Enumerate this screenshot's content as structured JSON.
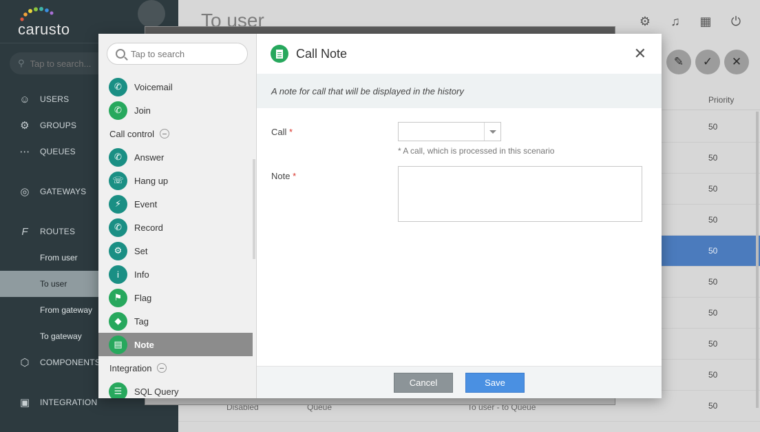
{
  "app": {
    "logo_text": "carusto",
    "page_title": "To user"
  },
  "sidebar": {
    "search_placeholder": "Tap to search...",
    "items": [
      {
        "label": "USERS",
        "icon": "user-icon"
      },
      {
        "label": "GROUPS",
        "icon": "groups-icon"
      },
      {
        "label": "QUEUES",
        "icon": "queues-icon"
      },
      {
        "label": "GATEWAYS",
        "icon": "globe-icon"
      },
      {
        "label": "ROUTES",
        "icon": "fx-icon"
      },
      {
        "label": "COMPONENTS",
        "icon": "cube-icon"
      },
      {
        "label": "INTEGRATION",
        "icon": "integration-icon"
      }
    ],
    "routes_sub": [
      "From user",
      "To user",
      "From gateway",
      "To gateway"
    ],
    "active_sub": "To user"
  },
  "table": {
    "priority_header": "Priority",
    "priorities": [
      "50",
      "50",
      "50",
      "50",
      "50",
      "50",
      "50",
      "50",
      "50",
      "50"
    ],
    "selected_row_index": 4,
    "bottom_row": {
      "status": "Disabled",
      "type": "Queue",
      "name": "To user - to Queue"
    }
  },
  "palette": {
    "search_placeholder": "Tap to search",
    "items_top": [
      {
        "label": "Voicemail",
        "icon": "voicemail-icon"
      },
      {
        "label": "Join",
        "icon": "join-icon"
      }
    ],
    "section_call_control": "Call control",
    "call_control_items": [
      {
        "label": "Answer",
        "icon": "answer-icon"
      },
      {
        "label": "Hang up",
        "icon": "hangup-icon"
      },
      {
        "label": "Event",
        "icon": "event-icon"
      },
      {
        "label": "Record",
        "icon": "record-icon"
      },
      {
        "label": "Set",
        "icon": "set-icon"
      },
      {
        "label": "Info",
        "icon": "info-icon"
      },
      {
        "label": "Flag",
        "icon": "flag-icon"
      },
      {
        "label": "Tag",
        "icon": "tag-icon"
      },
      {
        "label": "Note",
        "icon": "note-icon"
      }
    ],
    "active_item": "Note",
    "section_integration": "Integration",
    "integration_items": [
      {
        "label": "SQL Query",
        "icon": "database-icon"
      }
    ]
  },
  "dialog": {
    "title": "Call Note",
    "description": "A note for call that will be displayed in the history",
    "call_label": "Call",
    "call_value": "",
    "call_hint": "* A call, which is processed in this scenario",
    "note_label": "Note",
    "note_value": "",
    "required_mark": "*",
    "cancel_label": "Cancel",
    "save_label": "Save"
  },
  "colors": {
    "accent_blue": "#4a90e2",
    "green": "#27a85d",
    "teal": "#1a8f84",
    "selected_row": "#4b7bbd",
    "sidebar_bg": "#2d3a3f"
  }
}
